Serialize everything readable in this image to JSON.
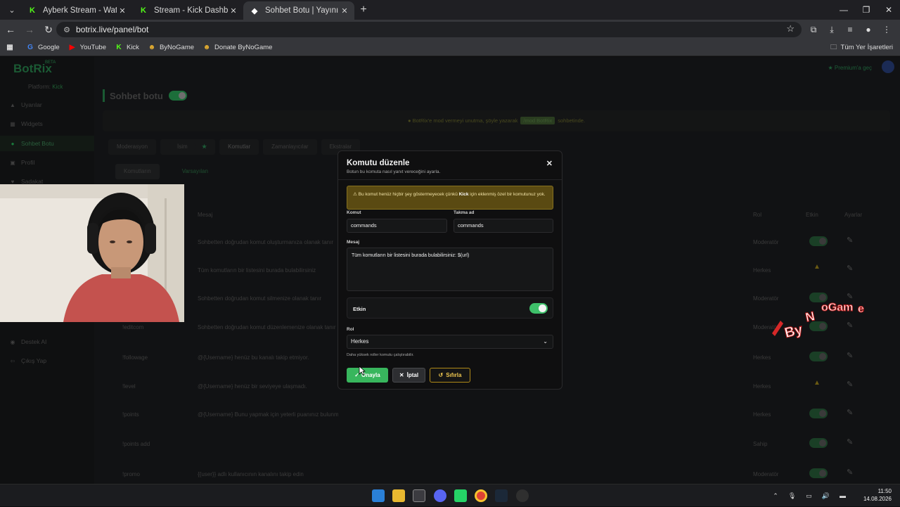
{
  "browser": {
    "tabs": [
      {
        "title": "Ayberk Stream - Watch Live on",
        "active": false
      },
      {
        "title": "Stream - Kick Dashboard",
        "active": false
      },
      {
        "title": "Sohbet Botu | Yayınını güçlendi",
        "active": true
      }
    ],
    "url": "botrix.live/panel/bot",
    "bookmarks": [
      "Google",
      "YouTube",
      "Kick",
      "ByNoGame",
      "Donate ByNoGame"
    ],
    "all_bookmarks": "Tüm Yer İşaretleri"
  },
  "app": {
    "logo": "BotRix",
    "beta": "BETA",
    "platform_label": "Platform:",
    "platform_value": "Kick",
    "premium": "Premium'a geç",
    "sidebar": [
      {
        "label": "Uyarılar",
        "icon": "warning-icon"
      },
      {
        "label": "Widgets",
        "icon": "grid-icon"
      },
      {
        "label": "Sohbet Botu",
        "icon": "chat-icon",
        "active": true
      },
      {
        "label": "Profil",
        "icon": "profile-icon"
      },
      {
        "label": "Sadakat",
        "icon": "loyalty-icon"
      },
      {
        "label": "Destek AI",
        "icon": "support-icon"
      },
      {
        "label": "Çıkış Yap",
        "icon": "logout-icon"
      }
    ],
    "page_title": "Sohbet botu",
    "banner": {
      "pre": "BotRix'e mod vermeyi unutma, şöyle yazarak",
      "tag": "/mod BotRix",
      "post": "sohbetinde."
    },
    "tabs": [
      "Moderasyon",
      "İsim",
      "Komutlar",
      "Zamanlayıcılar",
      "Ekstralar"
    ],
    "subtabs": [
      "Komutların",
      "Varsayılan"
    ],
    "table_headers": {
      "message": "Mesaj",
      "role": "Rol",
      "enabled": "Etkin",
      "settings": "Ayarlar"
    },
    "rows": [
      {
        "cmd": "",
        "msg": "Sohbetten doğrudan komut oluşturmanıza olanak tanır",
        "role": "Moderatör",
        "state": "on"
      },
      {
        "cmd": "",
        "msg": "Tüm komutların bir listesini burada bulabilirsiniz",
        "role": "Herkes",
        "state": "warn"
      },
      {
        "cmd": "",
        "msg": "Sohbetten doğrudan komut silmenize olanak tanır",
        "role": "Moderatör",
        "state": "on"
      },
      {
        "cmd": "!editcom",
        "msg": "Sohbetten doğrudan komut düzenlemenize olanak tanır",
        "role": "Moderatör",
        "state": "on"
      },
      {
        "cmd": "!followage",
        "msg": "@{Username} henüz bu kanalı takip etmiyor.",
        "role": "Herkes",
        "state": "on"
      },
      {
        "cmd": "!level",
        "msg": "@{Username} henüz bir seviyeye ulaşmadı.",
        "role": "Herkes",
        "state": "warn"
      },
      {
        "cmd": "!points",
        "msg": "@{Username} Bunu yapmak için yeterli puanınız bulunmamaktadır",
        "role": "Herkes",
        "state": "on"
      },
      {
        "cmd": "!points add",
        "msg": "",
        "role": "Sahip",
        "state": "on"
      },
      {
        "cmd": "!promo",
        "msg": "{{user}} adlı kullanıcının kanalını takip edin",
        "role": "Moderatör",
        "state": "on"
      }
    ]
  },
  "modal": {
    "title": "Komutu düzenle",
    "subtitle": "Botun bu komuta nasıl yanıt vereceğini ayarla.",
    "alert_pre": "Bu komut henüz hiçbir şey göstermeyecek çünkü",
    "alert_bold": "Kick",
    "alert_post": "için eklenmiş özel bir komutunuz yok.",
    "command_label": "Komut",
    "command_value": "commands",
    "alias_label": "Takma ad",
    "alias_value": "commands",
    "message_label": "Mesaj",
    "message_value": "Tüm komutların bir listesini burada bulabilirsiniz: $(url)",
    "enabled_label": "Etkin",
    "enabled": true,
    "role_label": "Rol",
    "role_value": "Herkes",
    "role_hint": "Daha yüksek roller komutu çalıştırabilir.",
    "confirm": "Onayla",
    "cancel": "İptal",
    "reset": "Sıfırla"
  },
  "overlay_text": "ByNoGame",
  "clock": {
    "time": "11:50",
    "date": "14.08.2026"
  },
  "colors": {
    "accent": "#38b65d",
    "warning": "#5a4a12",
    "kick": "#53fc18"
  }
}
